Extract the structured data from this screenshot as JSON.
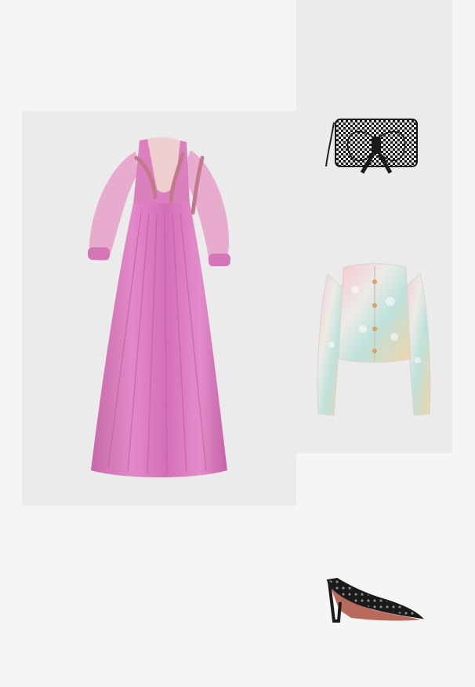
{
  "board": {
    "background": "#f5f5f5",
    "items": [
      {
        "product": "dress",
        "icon": "pink-tulle-gown",
        "tile_color": "#ebebeb",
        "colors": [
          "#d977bf",
          "#c86aa9",
          "#e6a0c8"
        ]
      },
      {
        "product": "clutch",
        "icon": "bow-clutch",
        "tile_color": "#ebebeb",
        "colors": [
          "#1a1a1a",
          "#e8e8e8"
        ]
      },
      {
        "product": "jacket",
        "icon": "sequin-cropped-jacket",
        "tile_color": "#ebebeb",
        "colors": [
          "#ecebe6",
          "#f3c7cf",
          "#bfe1db",
          "#f0d3a8"
        ]
      },
      {
        "product": "shoes",
        "icon": "embellished-pump",
        "tile_color": "#f5f5f5",
        "colors": [
          "#1a1a1a",
          "#6b6b6b",
          "#b86b5a"
        ]
      }
    ]
  }
}
